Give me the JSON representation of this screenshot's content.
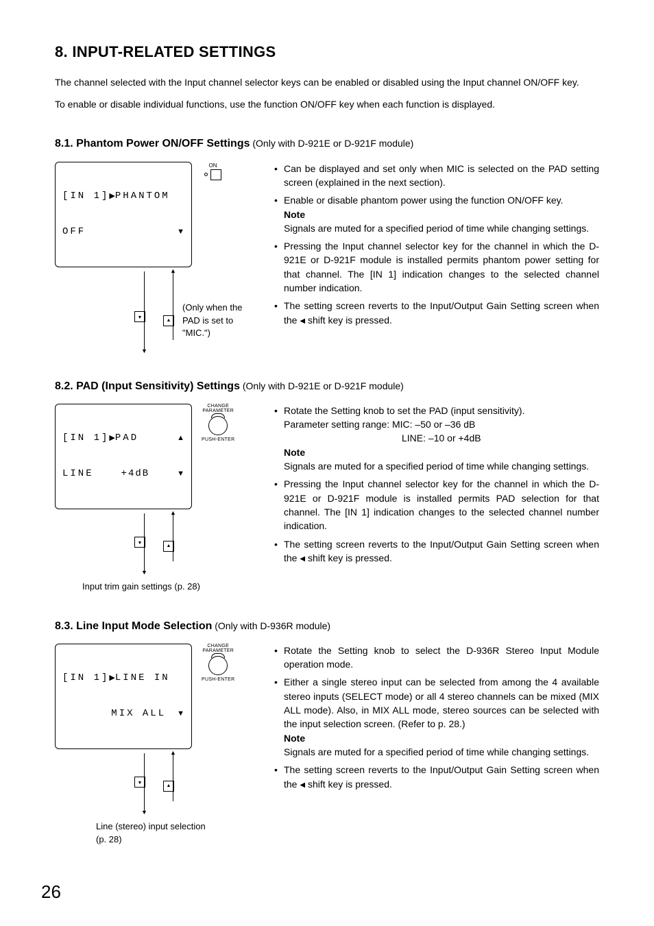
{
  "page_title": "8. INPUT-RELATED SETTINGS",
  "intro_p1": "The channel selected with the Input channel selector keys can be enabled or disabled using the Input channel ON/OFF key.",
  "intro_p2": "To enable or disable individual functions, use the function ON/OFF key when each function is displayed.",
  "s81": {
    "heading": "8.1. Phantom Power ON/OFF Settings",
    "module": " (Only with D-921E or D-921F module)",
    "lcd_l1_left": "[IN 1]",
    "lcd_l1_right": "PHANTOM",
    "lcd_l2": "OFF",
    "on_label": "ON",
    "only_note": "(Only when the PAD is set to \"MIC.\")",
    "b1": "Can be displayed and set only when MIC is selected on the PAD setting screen (explained in the next section).",
    "b2": "Enable or disable phantom power using the function ON/OFF key.",
    "note_label": "Note",
    "note": "Signals are muted for a specified period of time while changing settings.",
    "b3": "Pressing the Input channel selector key for the channel in which the D-921E or D-921F module is installed permits phantom power setting for that channel. The [IN 1] indication changes to the selected channel number indication.",
    "b4a": "The setting screen reverts to the Input/Output Gain Setting screen when the ",
    "b4b": " shift key is pressed."
  },
  "s82": {
    "heading": "8.2. PAD (Input Sensitivity) Settings",
    "module": " (Only with D-921E or D-921F module)",
    "lcd_l1_left": "[IN 1]",
    "lcd_l1_right": "PAD",
    "lcd_l2_left": "LINE",
    "lcd_l2_right": "+4dB",
    "knob_top": "CHANGE\nPARAMETER",
    "knob_bottom": "PUSH-ENTER",
    "caption": "Input trim gain settings (p. 28)",
    "b1": "Rotate the Setting knob to set the PAD (input sensitivity).",
    "range1": "Parameter setting range: MIC:   –50 or –36 dB",
    "range2": "LINE: –10 or +4dB",
    "note_label": "Note",
    "note": "Signals are muted for a specified period of time while changing settings.",
    "b2": "Pressing the Input channel selector key for the channel in which the D-921E or D-921F module is installed permits PAD selection for that channel. The [IN 1] indication changes to the selected channel number indication.",
    "b3a": "The setting screen reverts to the Input/Output Gain Setting screen when the ",
    "b3b": " shift key is pressed."
  },
  "s83": {
    "heading": "8.3. Line Input Mode Selection",
    "module": " (Only with D-936R module)",
    "lcd_l1_left": "[IN 1]",
    "lcd_l1_right": "LINE IN",
    "lcd_l2": "MIX ALL",
    "knob_top": "CHANGE\nPARAMETER",
    "knob_bottom": "PUSH-ENTER",
    "caption": "Line (stereo) input selection (p. 28)",
    "b1": "Rotate the Setting knob to select the D-936R Stereo Input Module operation mode.",
    "b2": "Either a single stereo input can be selected from among the 4 available stereo inputs (SELECT mode) or all 4 stereo channels can be mixed (MIX ALL mode). Also, in MIX ALL mode, stereo sources can be selected with the input selection screen. (Refer to p. 28.)",
    "note_label": "Note",
    "note": "Signals are muted for a specified period of time while changing settings.",
    "b3a": "The setting screen reverts to the Input/Output Gain Setting screen when the ",
    "b3b": " shift key is pressed."
  },
  "page_number": "26"
}
